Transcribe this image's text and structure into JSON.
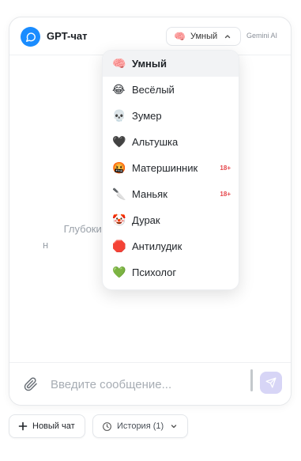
{
  "header": {
    "title": "GPT-чат",
    "mode_selected": "Умный",
    "mode_emoji": "🧠",
    "model_label": "Gemini AI"
  },
  "modes": [
    {
      "emoji": "🧠",
      "label": "Умный",
      "badge": "",
      "active": true
    },
    {
      "emoji": "😂",
      "label": "Весёлый",
      "badge": ""
    },
    {
      "emoji": "💀",
      "label": "Зумер",
      "badge": ""
    },
    {
      "emoji": "🖤",
      "label": "Альтушка",
      "badge": ""
    },
    {
      "emoji": "🤬",
      "label": "Матершинник",
      "badge": "18+"
    },
    {
      "emoji": "🔪",
      "label": "Маньяк",
      "badge": "18+"
    },
    {
      "emoji": "🤡",
      "label": "Дурак",
      "badge": ""
    },
    {
      "emoji": "🛑",
      "label": "Антилудик",
      "badge": ""
    },
    {
      "emoji": "💚",
      "label": "Психолог",
      "badge": ""
    }
  ],
  "empty_state": {
    "line1": "Глубокие от                                чнто-",
    "line2": "н"
  },
  "composer": {
    "placeholder": "Введите сообщение..."
  },
  "footer": {
    "new_chat_label": "Новый чат",
    "history_label": "История (1)"
  },
  "colors": {
    "accent": "#1a8cff",
    "send_button": "#d7d5f6",
    "badge": "#e5484d"
  }
}
